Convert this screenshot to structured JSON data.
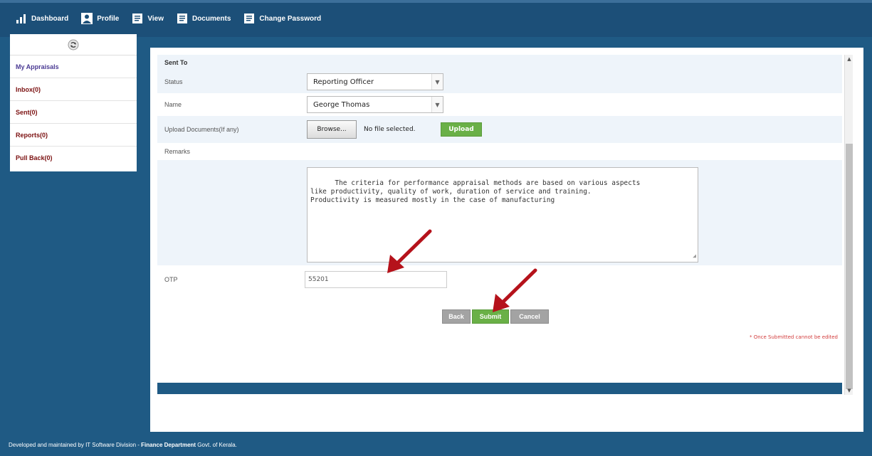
{
  "nav": {
    "items": [
      {
        "label": "Dashboard",
        "icon": "bar-chart-icon"
      },
      {
        "label": "Profile",
        "icon": "user-icon"
      },
      {
        "label": "View",
        "icon": "document-icon"
      },
      {
        "label": "Documents",
        "icon": "document-icon"
      },
      {
        "label": "Change Password",
        "icon": "document-icon"
      }
    ]
  },
  "sidebar": {
    "refresh_icon": "refresh-icon",
    "items": [
      {
        "label": "My Appraisals"
      },
      {
        "label": "Inbox(0)"
      },
      {
        "label": "Sent(0)"
      },
      {
        "label": "Reports(0)"
      },
      {
        "label": "Pull Back(0)"
      }
    ]
  },
  "form": {
    "section_title": "Sent To",
    "status_label": "Status",
    "status_value": "Reporting Officer",
    "name_label": "Name",
    "name_value": "George Thomas",
    "upload_label": "Upload Documents(If any)",
    "browse_label": "Browse...",
    "no_file_text": "No file selected.",
    "upload_button": "Upload",
    "remarks_label": "Remarks",
    "remarks_text": "The criteria for performance appraisal methods are based on various aspects\nlike productivity, quality of work, duration of service and training.\nProductivity is measured mostly in the case of manufacturing",
    "otp_label": "OTP",
    "otp_value": "55201",
    "back_button": "Back",
    "submit_button": "Submit",
    "cancel_button": "Cancel",
    "note": "* Once Submitted cannot be edited"
  },
  "footer": {
    "prefix": "Developed and maintained by IT Software Division - ",
    "dept": "Finance Department",
    "suffix": " Govt. of Kerala."
  },
  "colors": {
    "header": "#1c4f78",
    "background": "#1f5a84",
    "accent_green": "#6ab047",
    "annotation_arrow": "#b5121b"
  }
}
